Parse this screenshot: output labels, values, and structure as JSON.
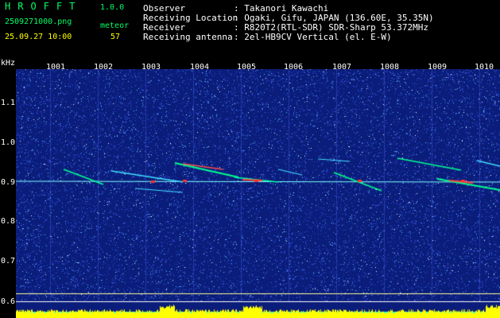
{
  "header": {
    "app_name": "HROFFT",
    "version": "1.0.0",
    "filename": "2509271000.png",
    "datetime": "25.09.27 10:00",
    "count_label": "meteor",
    "count_value": "57",
    "rows": [
      {
        "label": "Observer",
        "value": ": Takanori Kawachi"
      },
      {
        "label": "Receiving Location",
        "value": ": Ogaki, Gifu, JAPAN (136.60E, 35.35N)"
      },
      {
        "label": "Receiver",
        "value": ": R820T2(RTL-SDR) SDR-Sharp 53.372MHz"
      },
      {
        "label": "Receiving antenna",
        "value": ": 2el-HB9CV Vertical (el. E-W)"
      }
    ]
  },
  "axis": {
    "y_unit": "kHz",
    "y_labels": [
      "1.1",
      "1.0",
      "0.9",
      "0.8",
      "0.7",
      "0.6"
    ],
    "x_labels": [
      "1001",
      "1002",
      "1003",
      "1004",
      "1005",
      "1006",
      "1007",
      "1008",
      "1009",
      "1010"
    ]
  },
  "colors": {
    "background": "#000000",
    "spectrogram_base": "#0a1d7a",
    "text_green": "#00ff66",
    "text_yellow": "#ffff00",
    "signal_cyan": "#00ffff",
    "signal_hot": "#ff3030",
    "level_bar": "#ffff00"
  }
}
